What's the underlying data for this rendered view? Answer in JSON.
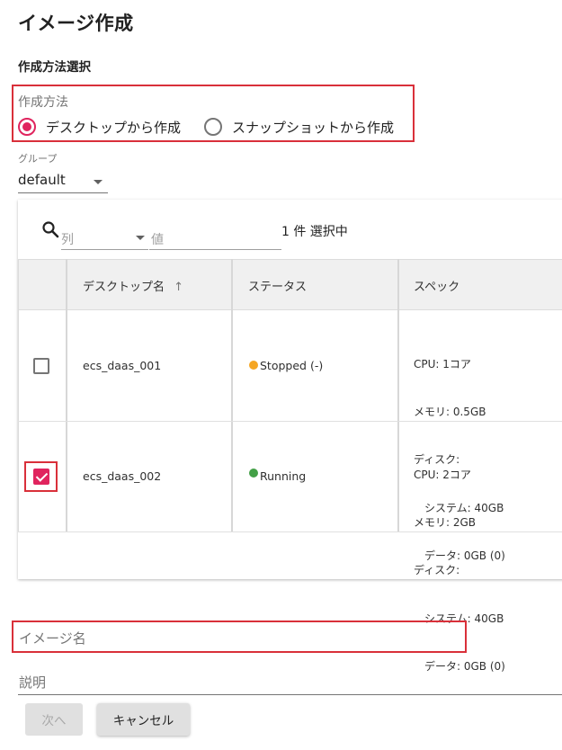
{
  "page": {
    "title": "イメージ作成",
    "section_title": "作成方法選択"
  },
  "method": {
    "legend": "作成方法",
    "options": [
      {
        "label": "デスクトップから作成",
        "selected": true
      },
      {
        "label": "スナップショットから作成",
        "selected": false
      }
    ]
  },
  "group": {
    "label": "グループ",
    "value": "default"
  },
  "filter": {
    "column_placeholder": "列",
    "value_placeholder": "値",
    "selected_count_text": "1 件 選択中"
  },
  "table": {
    "headers": {
      "name": "デスクトップ名",
      "sort_arrow": "↑",
      "status": "ステータス",
      "spec": "スペック"
    },
    "rows": [
      {
        "checked": false,
        "name": "ecs_daas_001",
        "status": "Stopped (-)",
        "status_type": "warning",
        "spec": [
          "CPU: 1コア",
          "メモリ: 0.5GB",
          "ディスク:",
          "　システム: 40GB",
          "　データ: 0GB (0)"
        ]
      },
      {
        "checked": true,
        "name": "ecs_daas_002",
        "status": "Running",
        "status_type": "ok",
        "spec": [
          "CPU: 2コア",
          "メモリ: 2GB",
          "ディスク:",
          "　システム: 40GB",
          "　データ: 0GB (0)"
        ]
      }
    ]
  },
  "form": {
    "image_name_placeholder": "イメージ名",
    "description_placeholder": "説明"
  },
  "buttons": {
    "next": "次へ",
    "cancel": "キャンセル"
  },
  "colors": {
    "accent": "#e0245e",
    "highlight": "#d9303a",
    "status_warning": "#f5a623",
    "status_ok": "#43a047"
  }
}
